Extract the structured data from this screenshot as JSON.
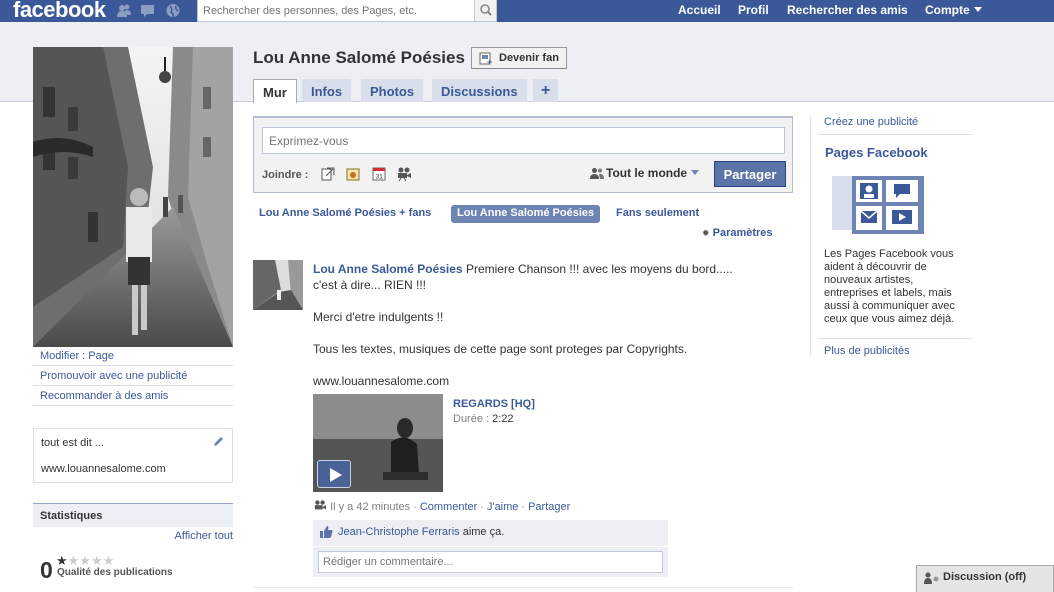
{
  "topbar": {
    "logo": "facebook",
    "search_placeholder": "Rechercher des personnes, des Pages, etc.",
    "nav": {
      "home": "Accueil",
      "profile": "Profil",
      "find_friends": "Rechercher des amis",
      "account": "Compte"
    },
    "colors": {
      "bar": "#3b5998"
    }
  },
  "page": {
    "title": "Lou Anne Salomé Poésies",
    "become_fan": "Devenir fan",
    "tabs": [
      {
        "label": "Mur",
        "active": true
      },
      {
        "label": "Infos"
      },
      {
        "label": "Photos"
      },
      {
        "label": "Discussions"
      },
      {
        "label": "+"
      }
    ]
  },
  "left": {
    "links": [
      "Modifier : Page",
      "Promouvoir avec une publicité",
      "Recommander à des amis"
    ],
    "info": {
      "line1": "tout est dit ...",
      "line2": "www.louannesalome.com"
    },
    "stats": {
      "title": "Statistiques",
      "see_all": "Afficher tout",
      "score": "0",
      "stars_filled": 1,
      "stars_total": 5,
      "label": "Qualité des publications"
    }
  },
  "publisher": {
    "placeholder": "Exprimez-vous",
    "attach_label": "Joindre :",
    "attach_icons": [
      "link-icon",
      "photo-icon",
      "event-icon",
      "video-icon"
    ],
    "privacy": "Tout le monde",
    "share": "Partager"
  },
  "filters": {
    "items": [
      {
        "label": "Lou Anne Salomé Poésies + fans"
      },
      {
        "label": "Lou Anne Salomé Poésies",
        "active": true
      },
      {
        "label": "Fans seulement"
      }
    ],
    "settings": "Paramètres"
  },
  "story": {
    "author": "Lou Anne Salomé Poésies",
    "text1": " Premiere Chanson !!! avec les moyens du bord..... c'est à dire... RIEN !!!",
    "text2": "Merci d'etre indulgents !!",
    "text3": "Tous les textes, musiques de cette page sont proteges par Copyrights.",
    "text4": "www.louannesalome.com",
    "video": {
      "title": "REGARDS [HQ]",
      "duration_label": "Durée :",
      "duration": "2:22"
    },
    "meta": {
      "time": "Il y a 42 minutes",
      "comment": "Commenter",
      "like": "J'aime",
      "share": "Partager"
    },
    "likes": {
      "person": "Jean-Christophe Ferraris",
      "suffix": " aime ça."
    },
    "comment_placeholder": "Rédiger un commentaire..."
  },
  "right": {
    "create_ad": "Créez une publicité",
    "pages_title": "Pages Facebook",
    "pages_desc": "Les Pages Facebook vous aident à découvrir de nouveaux artistes, entreprises et labels, mais aussi à communiquer avec ceux que vous aimez déjà.",
    "more_ads": "Plus de publicités"
  },
  "chat": {
    "label": "Discussion (off)"
  }
}
